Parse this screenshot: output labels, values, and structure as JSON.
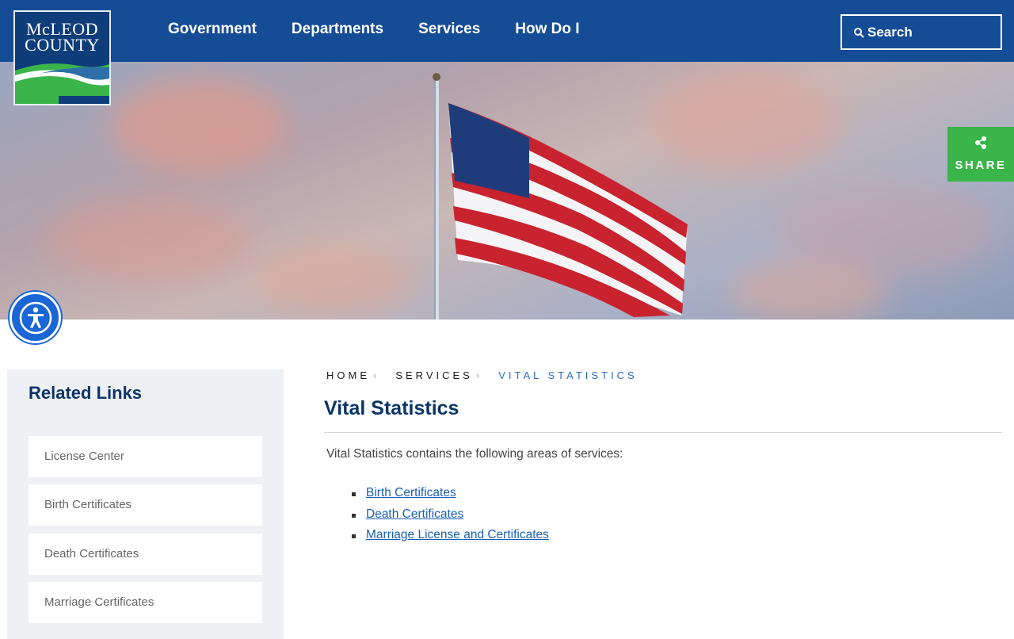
{
  "header": {
    "logo_line1": "McLEOD",
    "logo_line2": "COUNTY",
    "nav": [
      "Government",
      "Departments",
      "Services",
      "How Do I"
    ],
    "search_label": "Search"
  },
  "share": {
    "label": "SHARE"
  },
  "sidebar": {
    "title": "Related Links",
    "links": [
      "License Center",
      "Birth Certificates",
      "Death Certificates",
      "Marriage Certificates"
    ]
  },
  "breadcrumb": [
    "HOME",
    "SERVICES",
    "VITAL STATISTICS"
  ],
  "main": {
    "title": "Vital Statistics",
    "intro": "Vital Statistics contains the following areas of services:",
    "services": [
      "Birth Certificates",
      "Death Certificates",
      "Marriage License and Certificates"
    ]
  },
  "colors": {
    "header_bg": "#154c96",
    "title": "#0c3566",
    "link": "#1a5fb4",
    "share_bg": "#3ab54a",
    "accessibility": "#1a66d6"
  },
  "icons": [
    "search-icon",
    "share-icon",
    "accessibility-icon",
    "chevron-right-icon"
  ]
}
